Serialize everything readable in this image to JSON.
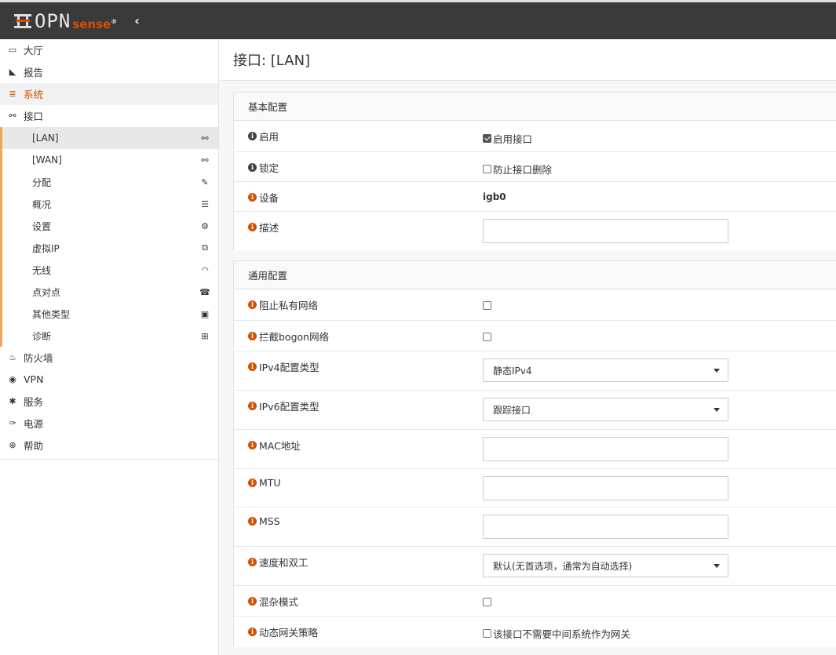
{
  "brand": {
    "logo_text": "OPN",
    "logo_sense": "sense",
    "reg_mark": "®",
    "collapse_glyph": "‹"
  },
  "sidebar": {
    "items": [
      {
        "label": "大厅",
        "icon": "laptop-icon",
        "glyph": "▭"
      },
      {
        "label": "报告",
        "icon": "area-chart-icon",
        "glyph": "◣"
      },
      {
        "label": "系统",
        "icon": "server-icon",
        "glyph": "≣"
      },
      {
        "label": "接口",
        "icon": "sitemap-icon",
        "glyph": "⚯"
      }
    ],
    "sub_items": [
      {
        "label": "[LAN]",
        "icon": "sitemap-icon",
        "glyph": "⚯"
      },
      {
        "label": "[WAN]",
        "icon": "sitemap-icon",
        "glyph": "⚯"
      },
      {
        "label": "分配",
        "icon": "pencil-icon",
        "glyph": "✎"
      },
      {
        "label": "概况",
        "icon": "tasks-icon",
        "glyph": "☰"
      },
      {
        "label": "设置",
        "icon": "cogs-icon",
        "glyph": "⚙"
      },
      {
        "label": "虚拟IP",
        "icon": "clone-icon",
        "glyph": "⧉"
      },
      {
        "label": "无线",
        "icon": "wifi-icon",
        "glyph": "◠"
      },
      {
        "label": "点对点",
        "icon": "phone-icon",
        "glyph": "☎"
      },
      {
        "label": "其他类型",
        "icon": "archive-icon",
        "glyph": "▣"
      },
      {
        "label": "诊断",
        "icon": "medkit-icon",
        "glyph": "⊞"
      }
    ],
    "items_after": [
      {
        "label": "防火墙",
        "icon": "fire-icon",
        "glyph": "♨"
      },
      {
        "label": "VPN",
        "icon": "globe-icon",
        "glyph": "◉"
      },
      {
        "label": "服务",
        "icon": "cog-icon",
        "glyph": "✱"
      },
      {
        "label": "电源",
        "icon": "plug-icon",
        "glyph": "✑"
      },
      {
        "label": "帮助",
        "icon": "life-ring-icon",
        "glyph": "⊕"
      }
    ]
  },
  "page": {
    "title": "接口: [LAN]"
  },
  "basic": {
    "heading": "基本配置",
    "enable": {
      "label": "启用",
      "checkbox_label": "启用接口",
      "checked": true
    },
    "lock": {
      "label": "锁定",
      "checkbox_label": "防止接口删除",
      "checked": false
    },
    "device": {
      "label": "设备",
      "value": "igb0"
    },
    "description": {
      "label": "描述",
      "value": ""
    }
  },
  "general": {
    "heading": "通用配置",
    "block_private": {
      "label": "阻止私有网络",
      "checked": false
    },
    "block_bogon": {
      "label": "拦截bogon网络",
      "checked": false
    },
    "ipv4_type": {
      "label": "IPv4配置类型",
      "value": "静态IPv4"
    },
    "ipv6_type": {
      "label": "IPv6配置类型",
      "value": "跟踪接口"
    },
    "mac": {
      "label": "MAC地址",
      "value": ""
    },
    "mtu": {
      "label": "MTU",
      "value": ""
    },
    "mss": {
      "label": "MSS",
      "value": ""
    },
    "speed": {
      "label": "速度和双工",
      "value": "默认(无首选项，通常为自动选择)"
    },
    "promisc": {
      "label": "混杂模式",
      "checked": false
    },
    "gateway_rules": {
      "label": "动态网关策略",
      "checkbox_label": "该接口不需要中间系统作为网关",
      "checked": false
    }
  },
  "colors": {
    "accent": "#d94f00",
    "topbar": "#3a3a3a",
    "submenu_border": "#f0a55a"
  }
}
